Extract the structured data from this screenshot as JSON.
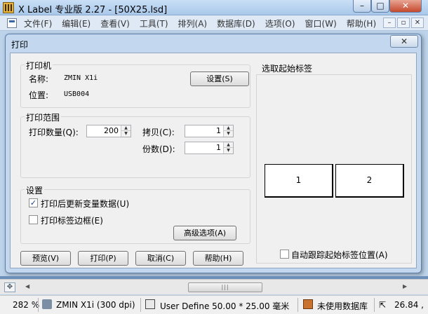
{
  "window": {
    "title": "X Label 专业版 2.27 - [50X25.lsd]",
    "min_glyph": "–",
    "max_glyph": "□",
    "close_glyph": "✕"
  },
  "menu": {
    "items": [
      "文件(F)",
      "编辑(E)",
      "查看(V)",
      "工具(T)",
      "排列(A)",
      "数据库(D)",
      "选项(O)",
      "窗口(W)",
      "帮助(H)"
    ],
    "mdi_min": "–",
    "mdi_restore": "▫",
    "mdi_close": "✕"
  },
  "dialog": {
    "title": "打印",
    "close_glyph": "✕",
    "printer": {
      "group_label": "打印机",
      "name_label": "名称:",
      "name_value": "ZMIN X1i",
      "location_label": "位置:",
      "location_value": "USB004",
      "setup_button": "设置(S)"
    },
    "range": {
      "group_label": "打印范围",
      "quantity_label": "打印数量(Q):",
      "quantity_value": "200",
      "copies_label": "拷贝(C):",
      "copies_value": "1",
      "sets_label": "份数(D):",
      "sets_value": "1"
    },
    "settings": {
      "group_label": "设置",
      "update_vars_label": "打印后更新变量数据(U)",
      "update_vars_checked": true,
      "print_border_label": "打印标签边框(E)",
      "print_border_checked": false,
      "advanced_button": "高级选项(A)"
    },
    "start_label": {
      "title": "选取起始标签",
      "cells": [
        "1",
        "2"
      ],
      "auto_track_label": "自动跟踪起始标签位置(A)",
      "auto_track_checked": false
    },
    "buttons": {
      "preview": "预览(V)",
      "print": "打印(P)",
      "cancel": "取消(C)",
      "help": "帮助(H)"
    }
  },
  "statusbar": {
    "zoom": "282 %",
    "printer": "ZMIN X1i (300 dpi)",
    "page_size": "User Define  50.00 * 25.00 毫米",
    "database": "未使用数据库",
    "cursor": "26.84 ,"
  },
  "colors": {
    "titlebar": "#bcd3ea",
    "dialog_frame": "#c3d8ef",
    "client": "#f0f0f0"
  }
}
